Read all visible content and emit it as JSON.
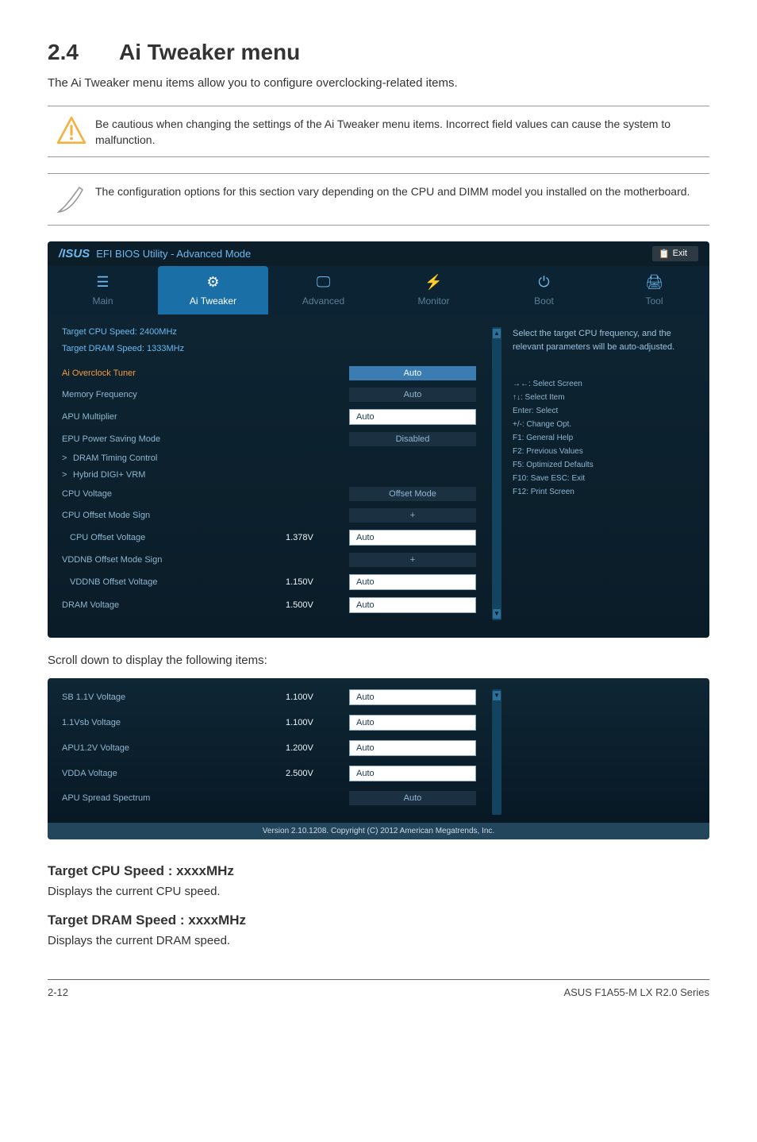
{
  "heading": {
    "num": "2.4",
    "title": "Ai Tweaker menu"
  },
  "intro": "The Ai Tweaker menu items allow you to configure overclocking-related items.",
  "warn_note": "Be cautious when changing the settings of the Ai Tweaker menu items. Incorrect field values can cause the system to malfunction.",
  "config_note": "The configuration options for this section vary depending on the CPU and DIMM model you installed on the motherboard.",
  "bios": {
    "brand": "/ISUS",
    "title": "EFI BIOS Utility - Advanced Mode",
    "exit": "Exit",
    "tabs": {
      "main": "Main",
      "ai": "Ai  Tweaker",
      "adv": "Advanced",
      "mon": "Monitor",
      "boot": "Boot",
      "tool": "Tool"
    },
    "info": {
      "cpu": "Target CPU Speed: 2400MHz",
      "dram": "Target DRAM Speed: 1333MHz"
    },
    "rows": {
      "ai_oc": {
        "label": "Ai Overclock Tuner",
        "value": "Auto"
      },
      "mem": {
        "label": "Memory Frequency",
        "value": "Auto"
      },
      "apu": {
        "label": "APU Multiplier",
        "value": "Auto"
      },
      "epu": {
        "label": "EPU Power Saving Mode",
        "value": "Disabled"
      },
      "dram_timing": "DRAM Timing Control",
      "hybrid": "Hybrid DIGI+ VRM",
      "cpuv": {
        "label": "CPU Voltage",
        "value": "Offset Mode"
      },
      "cpu_off_sign": {
        "label": "CPU Offset Mode Sign",
        "value": "+"
      },
      "cpu_off_v": {
        "label": "CPU Offset Voltage",
        "mid": "1.378V",
        "value": "Auto"
      },
      "vddnb_sign": {
        "label": "VDDNB Offset Mode Sign",
        "value": "+"
      },
      "vddnb_v": {
        "label": "VDDNB Offset Voltage",
        "mid": "1.150V",
        "value": "Auto"
      },
      "dramv": {
        "label": "DRAM Voltage",
        "mid": "1.500V",
        "value": "Auto"
      }
    },
    "help": "Select the target CPU frequency, and the relevant parameters will be auto-adjusted.",
    "kb": {
      "l1": "→←: Select Screen",
      "l2": "↑↓: Select Item",
      "l3": "Enter: Select",
      "l4": "+/-: Change Opt.",
      "l5": "F1: General Help",
      "l6": "F2: Previous Values",
      "l7": "F5: Optimized Defaults",
      "l8": "F10: Save   ESC: Exit",
      "l9": "F12: Print Screen"
    }
  },
  "scroll": "Scroll down to display the following items:",
  "bios2": {
    "rows": {
      "sb": {
        "label": "SB 1.1V Voltage",
        "mid": "1.100V",
        "value": "Auto"
      },
      "vsb": {
        "label": "1.1Vsb Voltage",
        "mid": "1.100V",
        "value": "Auto"
      },
      "apu12": {
        "label": "APU1.2V Voltage",
        "mid": "1.200V",
        "value": "Auto"
      },
      "vdda": {
        "label": "VDDA Voltage",
        "mid": "2.500V",
        "value": "Auto"
      },
      "spread": {
        "label": "APU Spread Spectrum",
        "value": "Auto"
      }
    },
    "version": "Version  2.10.1208.  Copyright  (C)  2012  American  Megatrends,  Inc."
  },
  "sec1": {
    "h": "Target CPU Speed : xxxxMHz",
    "t": "Displays the current CPU speed."
  },
  "sec2": {
    "h": "Target DRAM Speed : xxxxMHz",
    "t": "Displays the current DRAM speed."
  },
  "footer": {
    "left": "2-12",
    "right": "ASUS F1A55-M LX R2.0 Series"
  }
}
